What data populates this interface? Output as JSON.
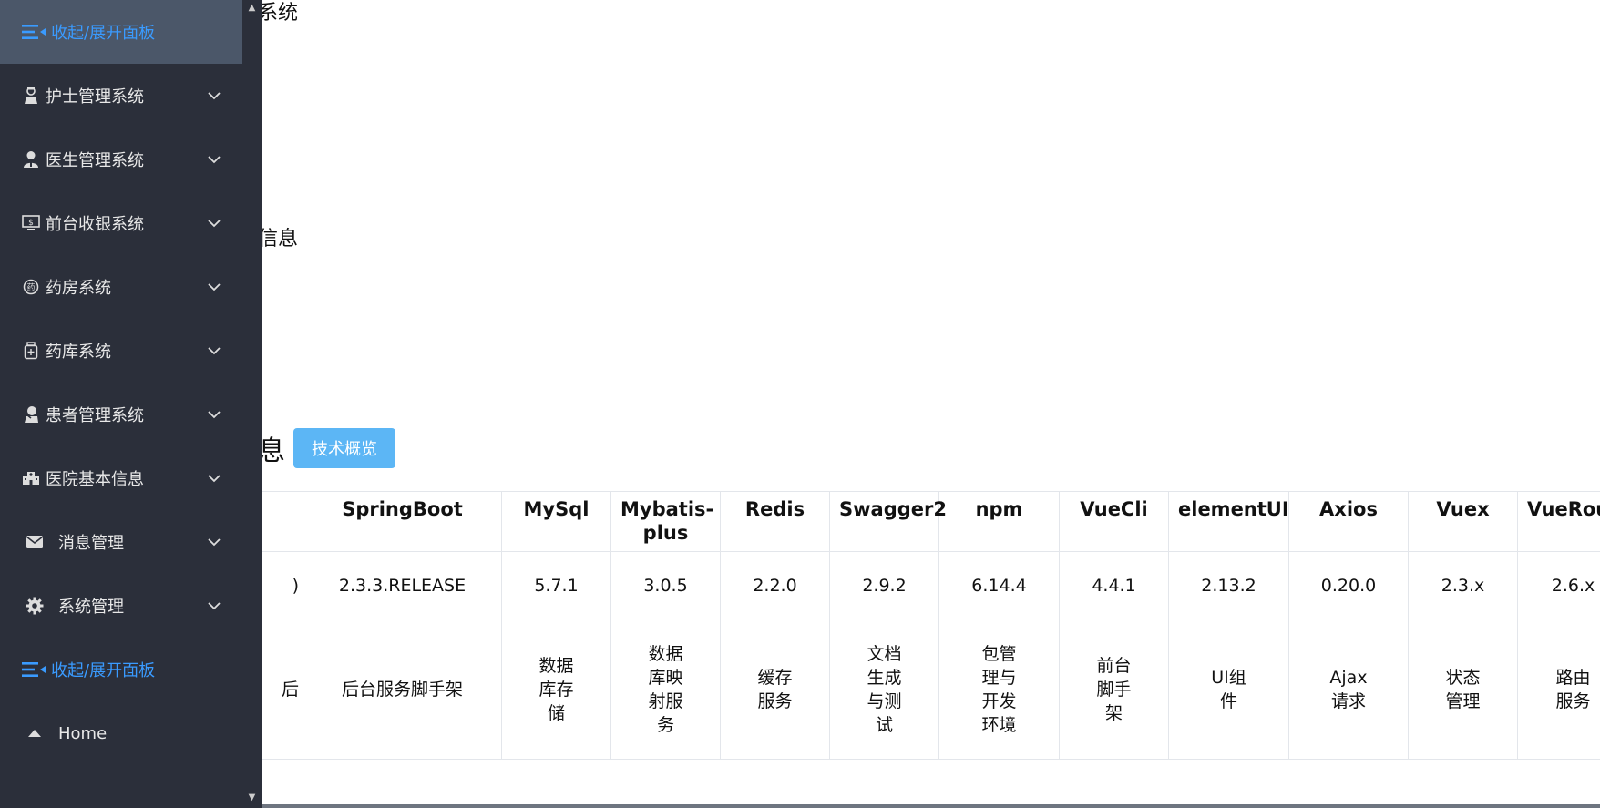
{
  "sidebar": {
    "collapse_top": "收起/展开面板",
    "items": [
      {
        "label": "护士管理系统",
        "icon": "nurse-icon"
      },
      {
        "label": "医生管理系统",
        "icon": "doctor-icon"
      },
      {
        "label": "前台收银系统",
        "icon": "cashier-monitor-icon"
      },
      {
        "label": "药房系统",
        "icon": "pharmacy-icon"
      },
      {
        "label": "药库系统",
        "icon": "medicine-bottle-icon"
      },
      {
        "label": "患者管理系统",
        "icon": "patient-icon"
      },
      {
        "label": "医院基本信息",
        "icon": "hospital-icon"
      },
      {
        "label": "消息管理",
        "icon": "envelope-icon"
      },
      {
        "label": "系统管理",
        "icon": "gear-icon"
      }
    ],
    "collapse_bottom": "收起/展开面板",
    "home": "Home"
  },
  "main": {
    "clipped_heading_1": "系统",
    "clipped_heading_2": "信息",
    "clipped_heading_3": "息",
    "tech_button": "技术概览",
    "table": {
      "first_col": [
        "",
        ")",
        "后"
      ],
      "headers": [
        "SpringBoot",
        "MySql",
        "Mybatis-plus",
        "Redis",
        "Swagger2",
        "npm",
        "VueCli",
        "elementUI",
        "Axios",
        "Vuex",
        "VueRouter"
      ],
      "versions": [
        "2.3.3.RELEASE",
        "5.7.1",
        "3.0.5",
        "2.2.0",
        "2.9.2",
        "6.14.4",
        "4.4.1",
        "2.13.2",
        "0.20.0",
        "2.3.x",
        "2.6.x"
      ],
      "descriptions": [
        "后台服务脚手架",
        "数据库存储",
        "数据库映射服务",
        "缓存服务",
        "文档生成与测试",
        "包管理与开发环境",
        "前台脚手架",
        "UI组件",
        "Ajax请求",
        "状态管理",
        "路由服务"
      ]
    }
  },
  "colors": {
    "sidebar_bg": "#2b2f3a",
    "sidebar_active_bg": "#4b5769",
    "accent_blue": "#3a9bff",
    "button_bg": "#5cb6f5"
  }
}
